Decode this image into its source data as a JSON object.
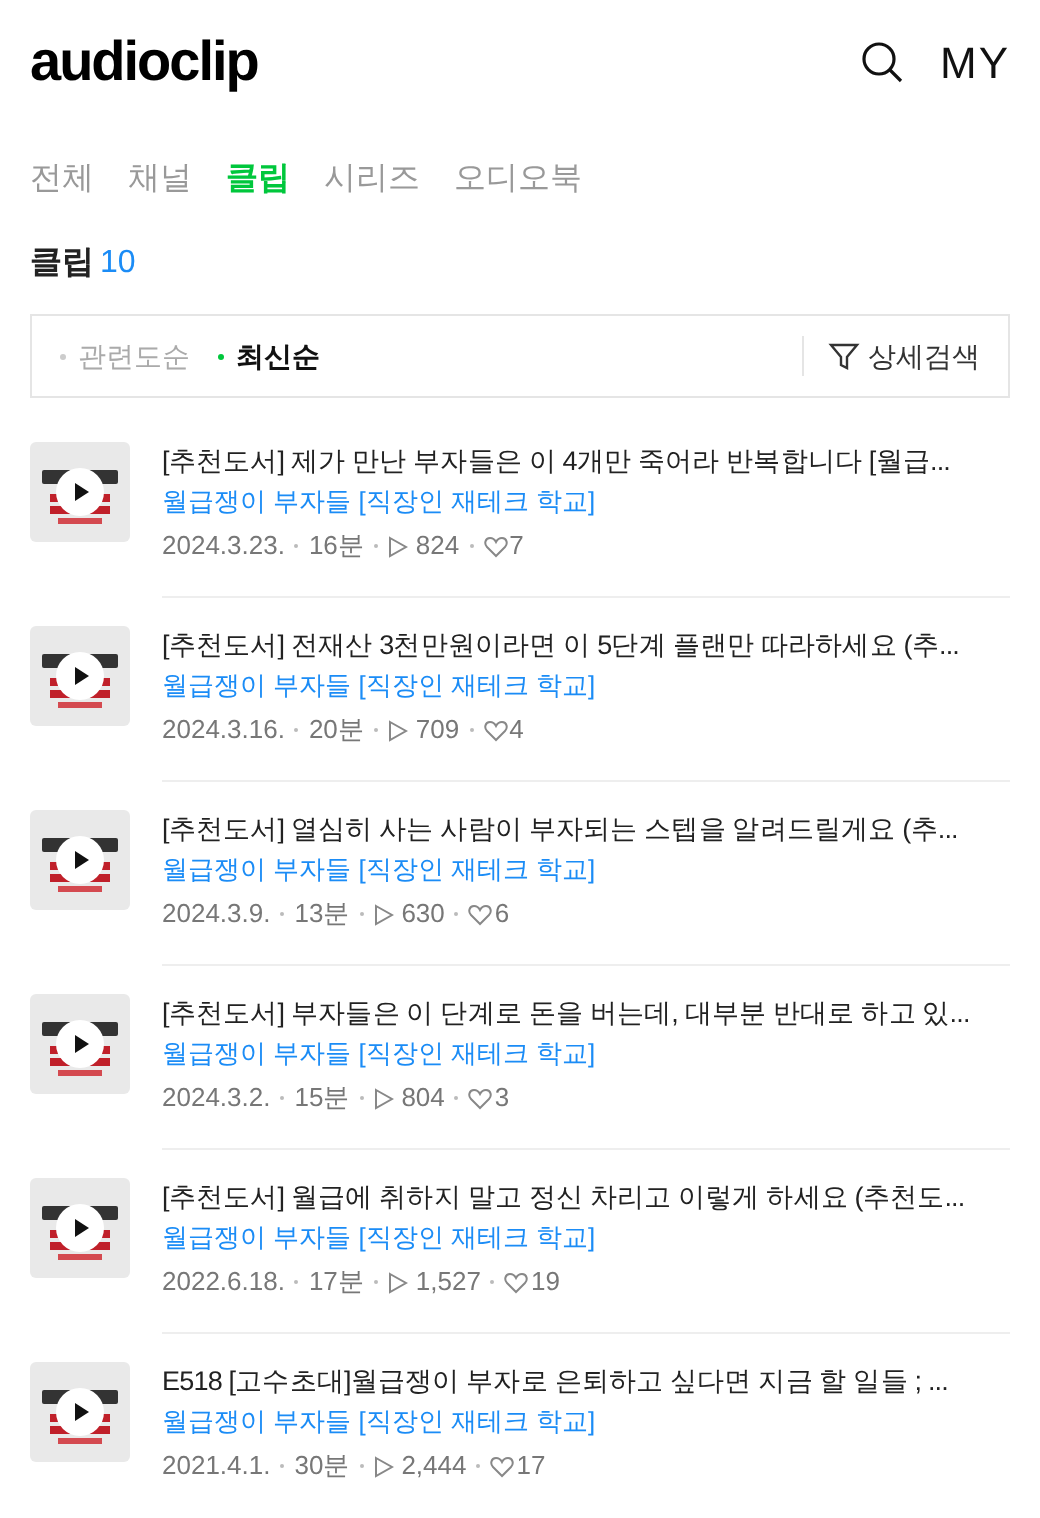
{
  "header": {
    "logo": "audioclip",
    "my_label": "MY"
  },
  "tabs": [
    {
      "label": "전체",
      "selected": false
    },
    {
      "label": "채널",
      "selected": false
    },
    {
      "label": "클립",
      "selected": true
    },
    {
      "label": "시리즈",
      "selected": false
    },
    {
      "label": "오디오북",
      "selected": false
    }
  ],
  "section": {
    "title": "클립",
    "count": "10"
  },
  "sort_options": [
    {
      "label": "관련도순",
      "selected": false
    },
    {
      "label": "최신순",
      "selected": true
    }
  ],
  "filter_button": "상세검색",
  "clips": [
    {
      "title": "[추천도서] 제가 만난 부자들은 이 4개만 죽어라 반복합니다 [월급...",
      "channel": "월급쟁이 부자들 [직장인 재테크 학교]",
      "date": "2024.3.23.",
      "duration": "16분",
      "plays": "824",
      "likes": "7"
    },
    {
      "title": "[추천도서] 전재산 3천만원이라면 이 5단계 플랜만 따라하세요 (추...",
      "channel": "월급쟁이 부자들 [직장인 재테크 학교]",
      "date": "2024.3.16.",
      "duration": "20분",
      "plays": "709",
      "likes": "4"
    },
    {
      "title": "[추천도서] 열심히 사는 사람이 부자되는 스텝을 알려드릴게요 (추...",
      "channel": "월급쟁이 부자들 [직장인 재테크 학교]",
      "date": "2024.3.9.",
      "duration": "13분",
      "plays": "630",
      "likes": "6"
    },
    {
      "title": "[추천도서] 부자들은 이 단계로 돈을 버는데, 대부분 반대로 하고 있...",
      "channel": "월급쟁이 부자들 [직장인 재테크 학교]",
      "date": "2024.3.2.",
      "duration": "15분",
      "plays": "804",
      "likes": "3"
    },
    {
      "title": "[추천도서] 월급에 취하지 말고 정신 차리고 이렇게 하세요 (추천도...",
      "channel": "월급쟁이 부자들 [직장인 재테크 학교]",
      "date": "2022.6.18.",
      "duration": "17분",
      "plays": "1,527",
      "likes": "19"
    },
    {
      "title": "E518 [고수초대]월급쟁이 부자로 은퇴하고 싶다면 지금 할 일들 ; ...",
      "channel": "월급쟁이 부자들 [직장인 재테크 학교]",
      "date": "2021.4.1.",
      "duration": "30분",
      "plays": "2,444",
      "likes": "17"
    }
  ]
}
